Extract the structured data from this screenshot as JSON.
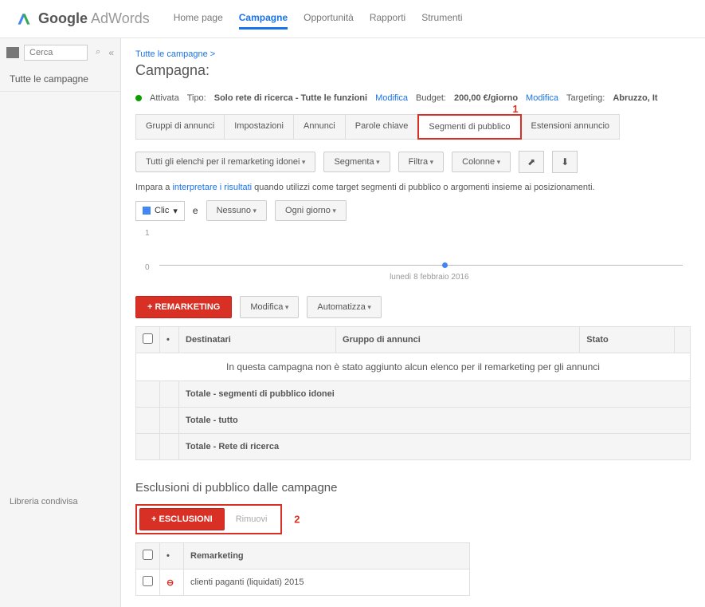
{
  "logo": {
    "g": "Google",
    "aw": "AdWords"
  },
  "nav": [
    "Home page",
    "Campagne",
    "Opportunità",
    "Rapporti",
    "Strumenti"
  ],
  "nav_active": 1,
  "sidebar": {
    "search_placeholder": "Cerca",
    "all_campaigns": "Tutte le campagne",
    "shared_library": "Libreria condivisa"
  },
  "breadcrumb": "Tutte le campagne >",
  "page_title": "Campagna:",
  "status": {
    "state": "Attivata",
    "type_label": "Tipo:",
    "type_value": "Solo rete di ricerca - Tutte le funzioni",
    "edit": "Modifica",
    "budget_label": "Budget:",
    "budget_value": "200,00 €/giorno",
    "targeting_label": "Targeting:",
    "targeting_value": "Abruzzo, It"
  },
  "sub_tabs": [
    "Gruppi di annunci",
    "Impostazioni",
    "Annunci",
    "Parole chiave",
    "Segmenti di pubblico",
    "Estensioni annuncio"
  ],
  "sub_tab_highlighted": 4,
  "annotations": {
    "one": "1",
    "two": "2"
  },
  "toolbar": {
    "lists": "Tutti gli elenchi per il remarketing idonei",
    "segment": "Segmenta",
    "filter": "Filtra",
    "columns": "Colonne"
  },
  "hint": {
    "pre": "Impara a ",
    "link": "interpretare i risultati",
    "post": " quando utilizzi come target segmenti di pubblico o argomenti insieme ai posizionamenti."
  },
  "filters": {
    "clic": "Clic",
    "e": "e",
    "nessuno": "Nessuno",
    "daily": "Ogni giorno"
  },
  "chart_data": {
    "type": "line",
    "x": [
      "lunedì 8 febbraio 2016"
    ],
    "values": [
      0
    ],
    "ylim": [
      0,
      1
    ],
    "date_label": "lunedì 8 febbraio 2016"
  },
  "actions": {
    "remarketing": "+ REMARKETING",
    "modify": "Modifica",
    "automate": "Automatizza"
  },
  "table": {
    "headers": [
      "",
      "•",
      "Destinatari",
      "Gruppo di annunci",
      "Stato",
      ""
    ],
    "empty_msg": "In questa campagna non è stato aggiunto alcun elenco per il remarketing per gli annunci",
    "totals": [
      "Totale - segmenti di pubblico idonei",
      "Totale - tutto",
      "Totale - Rete di ricerca"
    ]
  },
  "exclusions": {
    "title": "Esclusioni di pubblico dalle campagne",
    "add": "+ ESCLUSIONI",
    "remove": "Rimuovi",
    "headers": [
      "",
      "•",
      "Remarketing"
    ],
    "rows": [
      {
        "name": "clienti paganti (liquidati) 2015"
      }
    ]
  }
}
